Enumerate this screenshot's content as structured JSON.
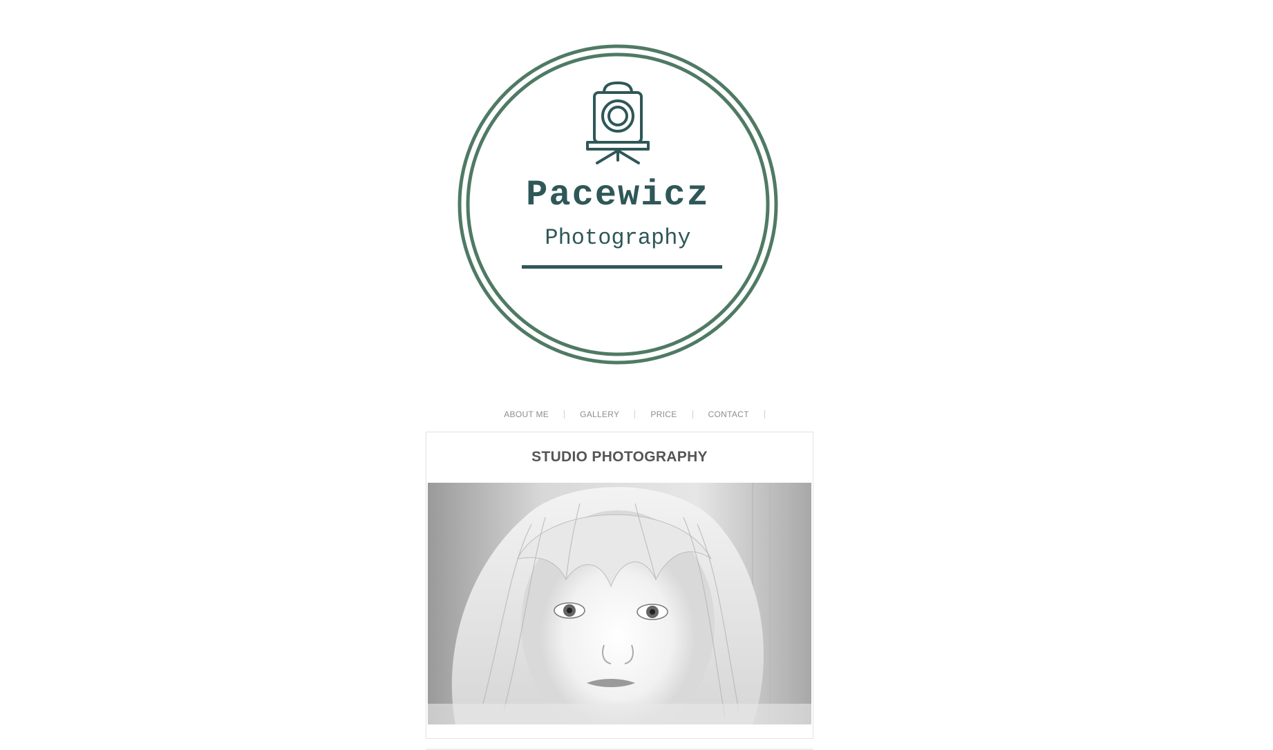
{
  "brand": {
    "name": "Pacewicz",
    "tagline": "Photography",
    "logo_icon": "camera-on-tripod-icon",
    "accent_color": "#4f7a63",
    "text_color": "#2f5758"
  },
  "nav": {
    "items": [
      {
        "label": "ABOUT ME"
      },
      {
        "label": "GALLERY"
      },
      {
        "label": "PRICE"
      },
      {
        "label": "CONTACT"
      }
    ]
  },
  "card": {
    "title": "STUDIO PHOTOGRAPHY",
    "image": "black-and-white-child-portrait"
  }
}
